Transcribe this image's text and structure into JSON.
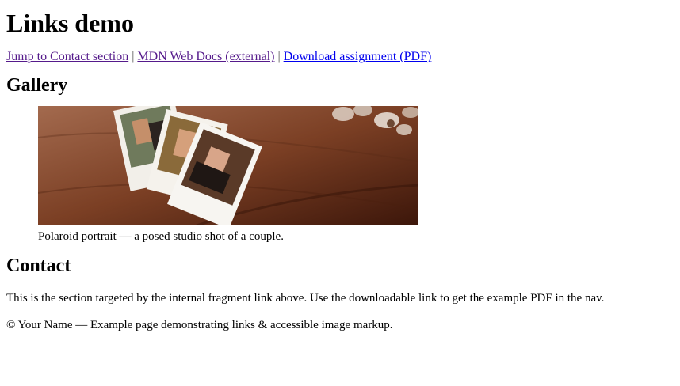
{
  "title": "Links demo",
  "nav": {
    "links": [
      {
        "label": "Jump to Contact section"
      },
      {
        "label": "MDN Web Docs (external)"
      },
      {
        "label": "Download assignment (PDF)"
      }
    ],
    "separator": "|"
  },
  "gallery": {
    "heading": "Gallery",
    "image_alt": "Polaroid photos of a couple on a wooden table",
    "caption": "Polaroid portrait — a posed studio shot of a couple."
  },
  "contact": {
    "heading": "Contact",
    "body": "This is the section targeted by the internal fragment link above. Use the downloadable link to get the example PDF in the nav."
  },
  "footer": {
    "text": "© Your Name — Example page demonstrating links & accessible image markup."
  },
  "colors": {
    "visited_link": "#551a8b",
    "unvisited_link": "#0000ee"
  }
}
